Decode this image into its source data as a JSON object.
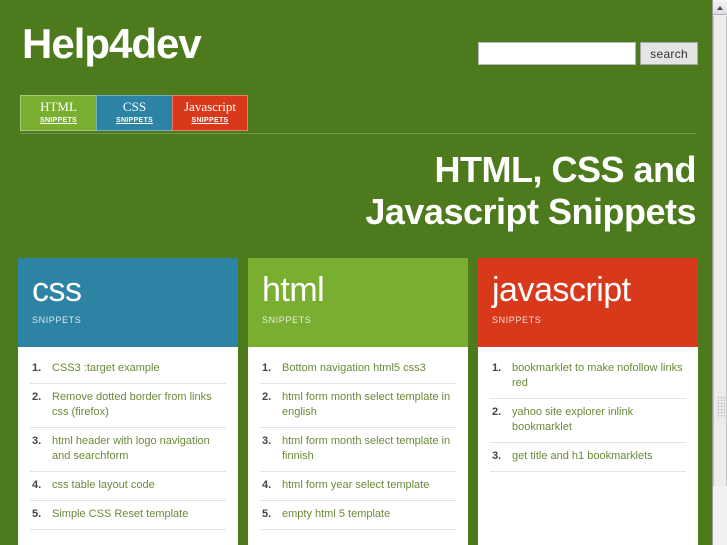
{
  "site": {
    "logo": "Help4dev",
    "page_title_line1": "HTML, CSS and",
    "page_title_line2": "Javascript Snippets"
  },
  "search": {
    "value": "",
    "placeholder": "",
    "button_label": "search"
  },
  "nav": {
    "tabs": [
      {
        "title": "HTML",
        "sub": "SNIPPETS",
        "color": "#79ae31"
      },
      {
        "title": "CSS",
        "sub": "SNIPPETS",
        "color": "#2d83a3"
      },
      {
        "title": "Javascript",
        "sub": "SNIPPETS",
        "color": "#d8391b"
      }
    ]
  },
  "cards": [
    {
      "title": "css",
      "sub": "SNIPPETS",
      "color": "#2d83a3",
      "items": [
        "CSS3 :target example",
        "Remove dotted border from links css (firefox)",
        "html header with logo navigation and searchform",
        "css table layout code",
        "Simple CSS Reset template"
      ]
    },
    {
      "title": "html",
      "sub": "SNIPPETS",
      "color": "#79ae31",
      "items": [
        "Bottom navigation html5 css3",
        "html form month select template in english",
        "html form month select template in finnish",
        "html form year select template",
        "empty html 5 template"
      ]
    },
    {
      "title": "javascript",
      "sub": "SNIPPETS",
      "color": "#d8391b",
      "items": [
        "bookmarklet to make nofollow links red",
        "yahoo site explorer inlink bookmarklet",
        "get title and h1 bookmarklets"
      ]
    }
  ],
  "theme": {
    "background": "#4e7a1e",
    "accent_blue": "#2d83a3",
    "accent_green": "#79ae31",
    "accent_red": "#d8391b",
    "link_text": "#6a8a38"
  },
  "scrollbar": {
    "up_arrow": "scroll-up-icon"
  }
}
